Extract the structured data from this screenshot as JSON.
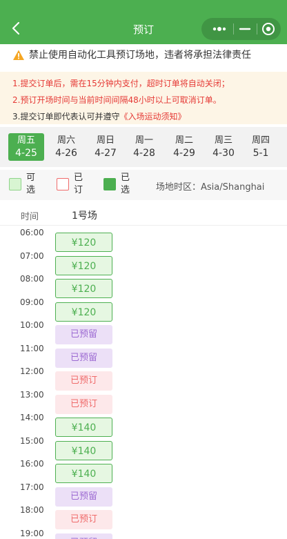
{
  "header": {
    "title": "预订"
  },
  "warning": {
    "text": "禁止使用自动化工具预订场地，违者将承担法律责任"
  },
  "notice": {
    "line1": "1.提交订单后，需在15分钟内支付，超时订单将自动关闭；",
    "line2": "2.预订开场时间与当前时间间隔48小时以上可取消订单。",
    "line3_prefix": "3.提交订单即代表认可并遵守",
    "line3_link": "《入场运动须知》"
  },
  "dates": [
    {
      "weekday": "周五",
      "date": "4-25",
      "active": true
    },
    {
      "weekday": "周六",
      "date": "4-26",
      "active": false
    },
    {
      "weekday": "周日",
      "date": "4-27",
      "active": false
    },
    {
      "weekday": "周一",
      "date": "4-28",
      "active": false
    },
    {
      "weekday": "周二",
      "date": "4-29",
      "active": false
    },
    {
      "weekday": "周三",
      "date": "4-30",
      "active": false
    },
    {
      "weekday": "周四",
      "date": "5-1",
      "active": false
    }
  ],
  "legend": {
    "available": "可选",
    "booked": "已订",
    "selected": "已选",
    "timezone": "场地时区：Asia/Shanghai"
  },
  "table": {
    "time_header": "时间",
    "court_header": "1号场",
    "rows": [
      {
        "time": "06:00",
        "status": "avail",
        "label": "¥120"
      },
      {
        "time": "07:00",
        "status": "avail",
        "label": "¥120"
      },
      {
        "time": "08:00",
        "status": "avail",
        "label": "¥120"
      },
      {
        "time": "09:00",
        "status": "avail",
        "label": "¥120"
      },
      {
        "time": "10:00",
        "status": "reserved",
        "label": "已预留"
      },
      {
        "time": "11:00",
        "status": "reserved",
        "label": "已预留"
      },
      {
        "time": "12:00",
        "status": "booked",
        "label": "已预订"
      },
      {
        "time": "13:00",
        "status": "booked",
        "label": "已预订"
      },
      {
        "time": "14:00",
        "status": "avail",
        "label": "¥140"
      },
      {
        "time": "15:00",
        "status": "avail",
        "label": "¥140"
      },
      {
        "time": "16:00",
        "status": "avail",
        "label": "¥140"
      },
      {
        "time": "17:00",
        "status": "reserved",
        "label": "已预留"
      },
      {
        "time": "18:00",
        "status": "booked",
        "label": "已预订"
      },
      {
        "time": "19:00",
        "status": "reserved",
        "label": "已预留"
      }
    ]
  },
  "icons": {
    "back": "chevron-left-icon",
    "more": "more-dots-icon",
    "minimize": "minimize-icon",
    "close": "target-close-icon",
    "warning": "warning-triangle-icon"
  },
  "colors": {
    "brand": "#4caf50",
    "available_bg": "#e6f7e2",
    "reserved_bg": "#ece0f7",
    "reserved_text": "#9c6ad2",
    "booked_bg": "#fde8ea",
    "booked_text": "#ef6a6a",
    "notice_text": "#e53935"
  }
}
